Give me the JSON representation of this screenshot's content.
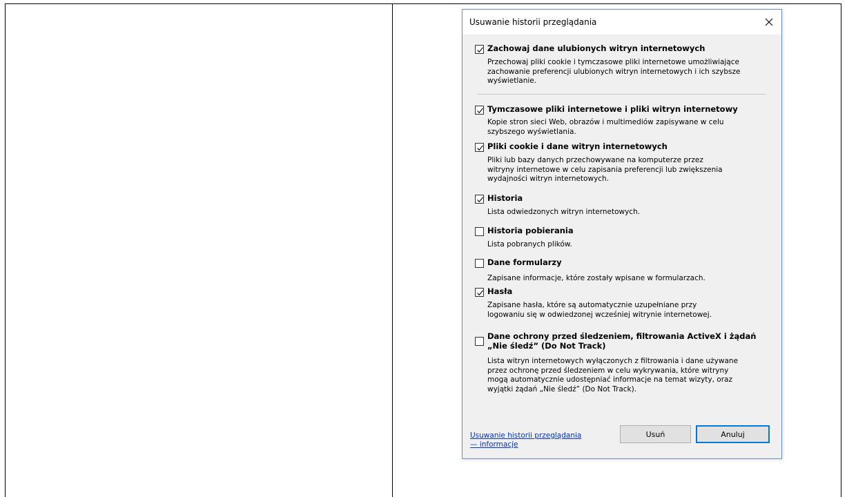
{
  "dialog": {
    "title": "Usuwanie historii przeglądania",
    "items": [
      {
        "label": "Zachowaj dane ulubionych witryn internetowych",
        "checked": true,
        "desc_lines": [
          "Przechowaj pliki cookie i tymczasowe pliki internetowe umożliwiające",
          "zachowanie preferencji ulubionych witryn internetowych i ich szybsze",
          "wyświetlanie."
        ]
      },
      {
        "label": "Tymczasowe pliki internetowe i pliki witryn internetowy",
        "checked": true,
        "desc_lines": [
          "Kopie stron sieci Web, obrazów i multimediów zapisywane w celu",
          "szybszego wyświetlania."
        ]
      },
      {
        "label": "Pliki cookie i dane witryn internetowych",
        "checked": true,
        "desc_lines": [
          "Pliki lub bazy danych przechowywane na komputerze przez",
          "witryny internetowe w celu zapisania preferencji lub zwiększenia",
          "wydajności witryn internetowych."
        ]
      },
      {
        "label": "Historia",
        "checked": true,
        "desc_lines": [
          "Lista odwiedzonych witryn internetowych."
        ]
      },
      {
        "label": "Historia pobierania",
        "checked": false,
        "desc_lines": [
          "Lista pobranych plików."
        ]
      },
      {
        "label": "Dane formularzy",
        "checked": false,
        "desc_lines": [
          "Zapisane informacje, które zostały wpisane w formularzach."
        ]
      },
      {
        "label": "Hasła",
        "checked": true,
        "desc_lines": [
          "Zapisane hasła, które są automatycznie uzupełniane przy",
          "logowaniu się w odwiedzonej wcześniej witrynie internetowej."
        ]
      },
      {
        "label_lines": [
          "Dane ochrony przed śledzeniem, filtrowania ActiveX i żądań",
          "„Nie śledź” (Do Not Track)"
        ],
        "checked": false,
        "desc_lines": [
          "Lista witryn internetowych wyłączonych z filtrowania i dane używane",
          "przez ochronę przed śledzeniem w celu wykrywania, które witryny",
          "mogą automatycznie udostępniać informacje na temat wizyty, oraz",
          "wyjątki żądań „Nie śledź” (Do Not Track)."
        ]
      }
    ],
    "help_link_lines": [
      "Usuwanie historii przeglądania",
      "— informacje"
    ],
    "delete_label": "Usuń",
    "cancel_label": "Anuluj"
  }
}
